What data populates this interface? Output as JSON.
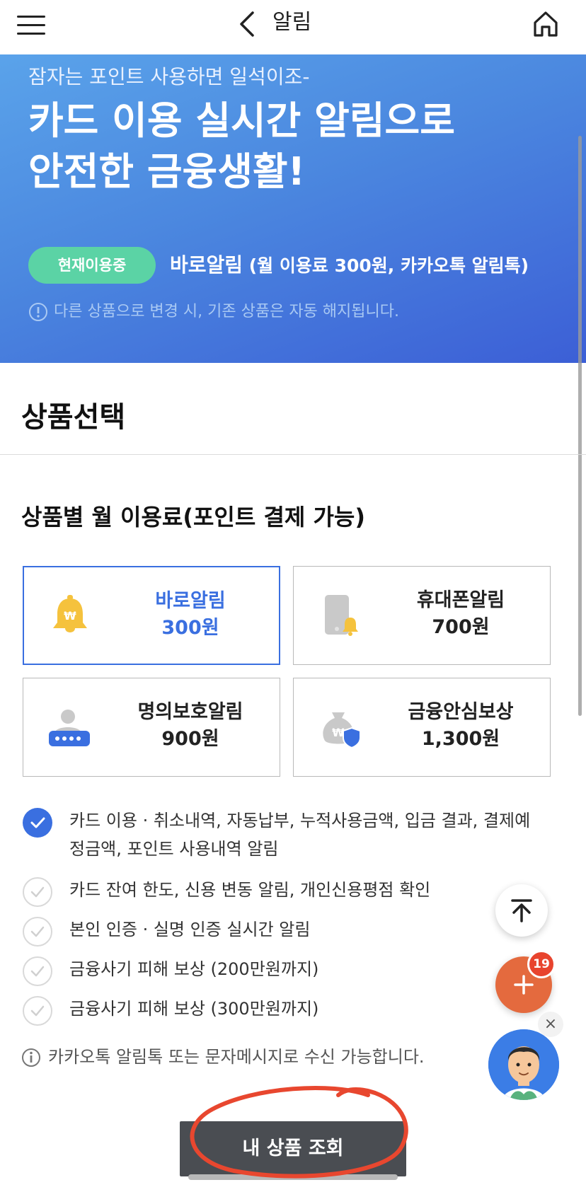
{
  "header": {
    "title": "알림"
  },
  "banner": {
    "subtitle": "잠자는 포인트 사용하면 일석이조-",
    "title_line1": "카드 이용 실시간 알림으로",
    "title_line2": "안전한 금융생활!",
    "badge": "현재이용중",
    "current_name": "바로알림",
    "current_detail": " (월 이용료 300원, 카카오톡 알림톡)",
    "notice": "다른 상품으로 변경 시, 기존 상품은 자동 해지됩니다."
  },
  "section": {
    "title": "상품선택",
    "subheading": "상품별 월 이용료(포인트 결제 가능)"
  },
  "products": [
    {
      "name": "바로알림",
      "price": "300원",
      "icon": "bell-won-icon",
      "selected": true
    },
    {
      "name": "휴대폰알림",
      "price": "700원",
      "icon": "phone-bell-icon",
      "selected": false
    },
    {
      "name": "명의보호알림",
      "price": "900원",
      "icon": "identity-protect-icon",
      "selected": false
    },
    {
      "name": "금융안심보상",
      "price": "1,300원",
      "icon": "money-bag-shield-icon",
      "selected": false
    }
  ],
  "features": [
    {
      "line1": "카드 이용 · 취소내역, 자동납부, 누적사용금액, 입금 결과, 결제예",
      "line2": "정금액, 포인트 사용내역 알림",
      "checked": true
    },
    {
      "line1": "카드 잔여 한도, 신용 변동 알림, 개인신용평점 확인",
      "checked": false
    },
    {
      "line1": "본인 인증 · 실명 인증 실시간 알림",
      "checked": false
    },
    {
      "line1": "금융사기 피해 보상 (200만원까지)",
      "checked": false
    },
    {
      "line1": "금융사기 피해 보상 (300만원까지)",
      "checked": false
    }
  ],
  "note": "카카오톡 알림톡 또는 문자메시지로 수신 가능합니다.",
  "cta": {
    "label": "내 상품 조회"
  },
  "floating": {
    "badge_count": "19"
  },
  "colors": {
    "accent": "#3a6fe0",
    "badge_green": "#5bd3a5",
    "fab_orange": "#e46a3e",
    "cta_dark": "#4a4d52",
    "annotation_red": "#e8472f"
  }
}
